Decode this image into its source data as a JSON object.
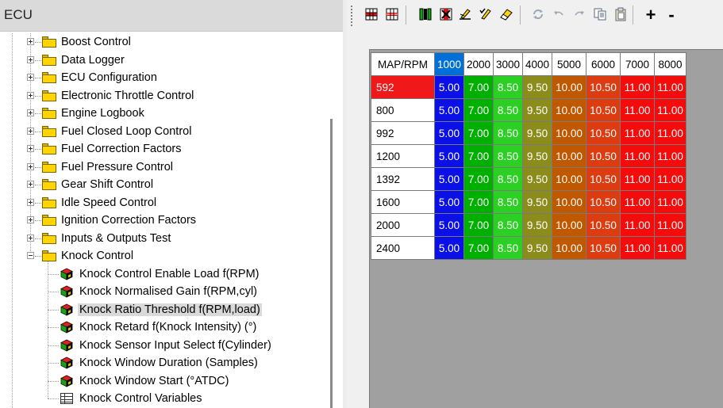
{
  "left": {
    "title": "ECU",
    "tree": {
      "folders": [
        {
          "label": "Boost Control"
        },
        {
          "label": "Data Logger"
        },
        {
          "label": "ECU Configuration"
        },
        {
          "label": "Electronic Throttle Control"
        },
        {
          "label": "Engine Logbook"
        },
        {
          "label": "Fuel Closed Loop Control"
        },
        {
          "label": "Fuel Correction Factors"
        },
        {
          "label": "Fuel Pressure Control"
        },
        {
          "label": "Gear Shift Control"
        },
        {
          "label": "Idle Speed Control"
        },
        {
          "label": "Ignition Correction Factors"
        },
        {
          "label": "Inputs & Outputs Test"
        },
        {
          "label": "Knock Control"
        }
      ],
      "knock_children": [
        {
          "label": "Knock Control Enable Load f(RPM)",
          "icon": "parameter-cube-icon"
        },
        {
          "label": "Knock Normalised Gain f(RPM,cyl)",
          "icon": "parameter-cube-icon"
        },
        {
          "label": "Knock Ratio Threshold f(RPM,load)",
          "icon": "parameter-cube-icon",
          "selected": true
        },
        {
          "label": "Knock Retard f(Knock Intensity) (°)",
          "icon": "parameter-cube-icon"
        },
        {
          "label": "Knock Sensor Input Select f(Cylinder)",
          "icon": "parameter-cube-icon"
        },
        {
          "label": "Knock Window Duration (Samples)",
          "icon": "parameter-cube-icon"
        },
        {
          "label": "Knock Window Start (°ATDC)",
          "icon": "parameter-cube-icon"
        },
        {
          "label": "Knock Control Variables",
          "icon": "variables-table-icon"
        }
      ]
    }
  },
  "toolbar": {
    "buttons": [
      {
        "name": "insert-row-icon"
      },
      {
        "name": "delete-row-icon"
      },
      {
        "name": "insert-column-icon"
      },
      {
        "name": "delete-column-icon"
      },
      {
        "name": "edit-pen-icon"
      },
      {
        "name": "edit-checkmark-icon"
      },
      {
        "name": "eraser-icon"
      },
      {
        "name": "refresh-icon"
      },
      {
        "name": "undo-icon"
      },
      {
        "name": "redo-icon"
      },
      {
        "name": "copy-icon"
      },
      {
        "name": "paste-icon"
      },
      {
        "name": "increase-icon",
        "glyph": "+"
      },
      {
        "name": "decrease-icon",
        "glyph": "-"
      }
    ]
  },
  "table": {
    "corner": "MAP/RPM",
    "columns": [
      "1000",
      "2000",
      "3000",
      "4000",
      "5000",
      "6000",
      "7000",
      "8000"
    ],
    "selected_column": 0,
    "selected_row": 0,
    "column_colors": [
      "#0a10e6",
      "#00b000",
      "#2cd024",
      "#8c8c1c",
      "#c05800",
      "#dc3c10",
      "#f40c0c",
      "#f40c0c"
    ],
    "rows": [
      {
        "label": "592",
        "values": [
          "5.00",
          "7.00",
          "8.50",
          "9.50",
          "10.00",
          "10.50",
          "11.00",
          "11.00"
        ]
      },
      {
        "label": "800",
        "values": [
          "5.00",
          "7.00",
          "8.50",
          "9.50",
          "10.00",
          "10.50",
          "11.00",
          "11.00"
        ]
      },
      {
        "label": "992",
        "values": [
          "5.00",
          "7.00",
          "8.50",
          "9.50",
          "10.00",
          "10.50",
          "11.00",
          "11.00"
        ]
      },
      {
        "label": "1200",
        "values": [
          "5.00",
          "7.00",
          "8.50",
          "9.50",
          "10.00",
          "10.50",
          "11.00",
          "11.00"
        ]
      },
      {
        "label": "1392",
        "values": [
          "5.00",
          "7.00",
          "8.50",
          "9.50",
          "10.00",
          "10.50",
          "11.00",
          "11.00"
        ]
      },
      {
        "label": "1600",
        "values": [
          "5.00",
          "7.00",
          "8.50",
          "9.50",
          "10.00",
          "10.50",
          "11.00",
          "11.00"
        ]
      },
      {
        "label": "2000",
        "values": [
          "5.00",
          "7.00",
          "8.50",
          "9.50",
          "10.00",
          "10.50",
          "11.00",
          "11.00"
        ]
      },
      {
        "label": "2400",
        "values": [
          "5.00",
          "7.00",
          "8.50",
          "9.50",
          "10.00",
          "10.50",
          "11.00",
          "11.00"
        ]
      }
    ]
  }
}
